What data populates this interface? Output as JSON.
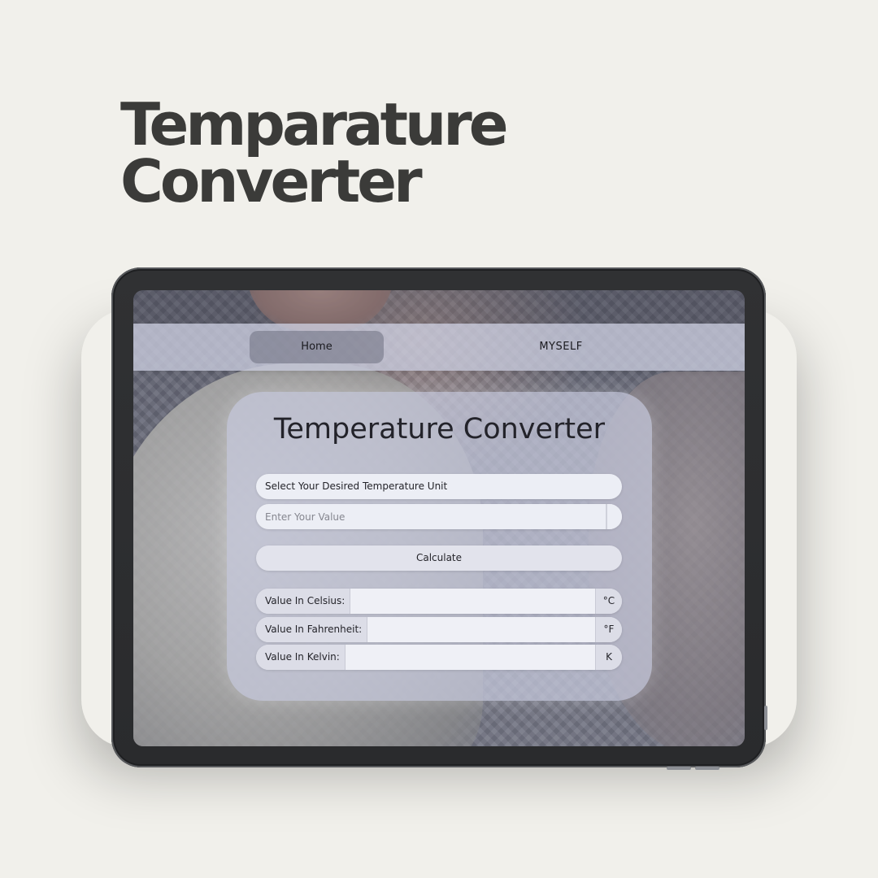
{
  "promo": {
    "title_line1": "Temparature",
    "title_line2": "Converter"
  },
  "nav": {
    "home_label": "Home",
    "myself_label": "MYSELF"
  },
  "converter": {
    "title": "Temperature Converter",
    "unit_select_value": "Select Your Desired Temperature Unit",
    "value_input_placeholder": "Enter Your Value",
    "value_input_value": "",
    "calculate_label": "Calculate",
    "results": [
      {
        "label": "Value In Celsius:",
        "value": "",
        "unit": "°C"
      },
      {
        "label": "Value In Fahrenheit:",
        "value": "",
        "unit": "°F"
      },
      {
        "label": "Value In Kelvin:",
        "value": "",
        "unit": "K"
      }
    ]
  },
  "colors": {
    "page_background": "#f1f0eb",
    "promo_text": "#3b3b39",
    "tablet_frame": "#303133",
    "card_background": "#c8cade",
    "field_background": "#eceef5"
  }
}
